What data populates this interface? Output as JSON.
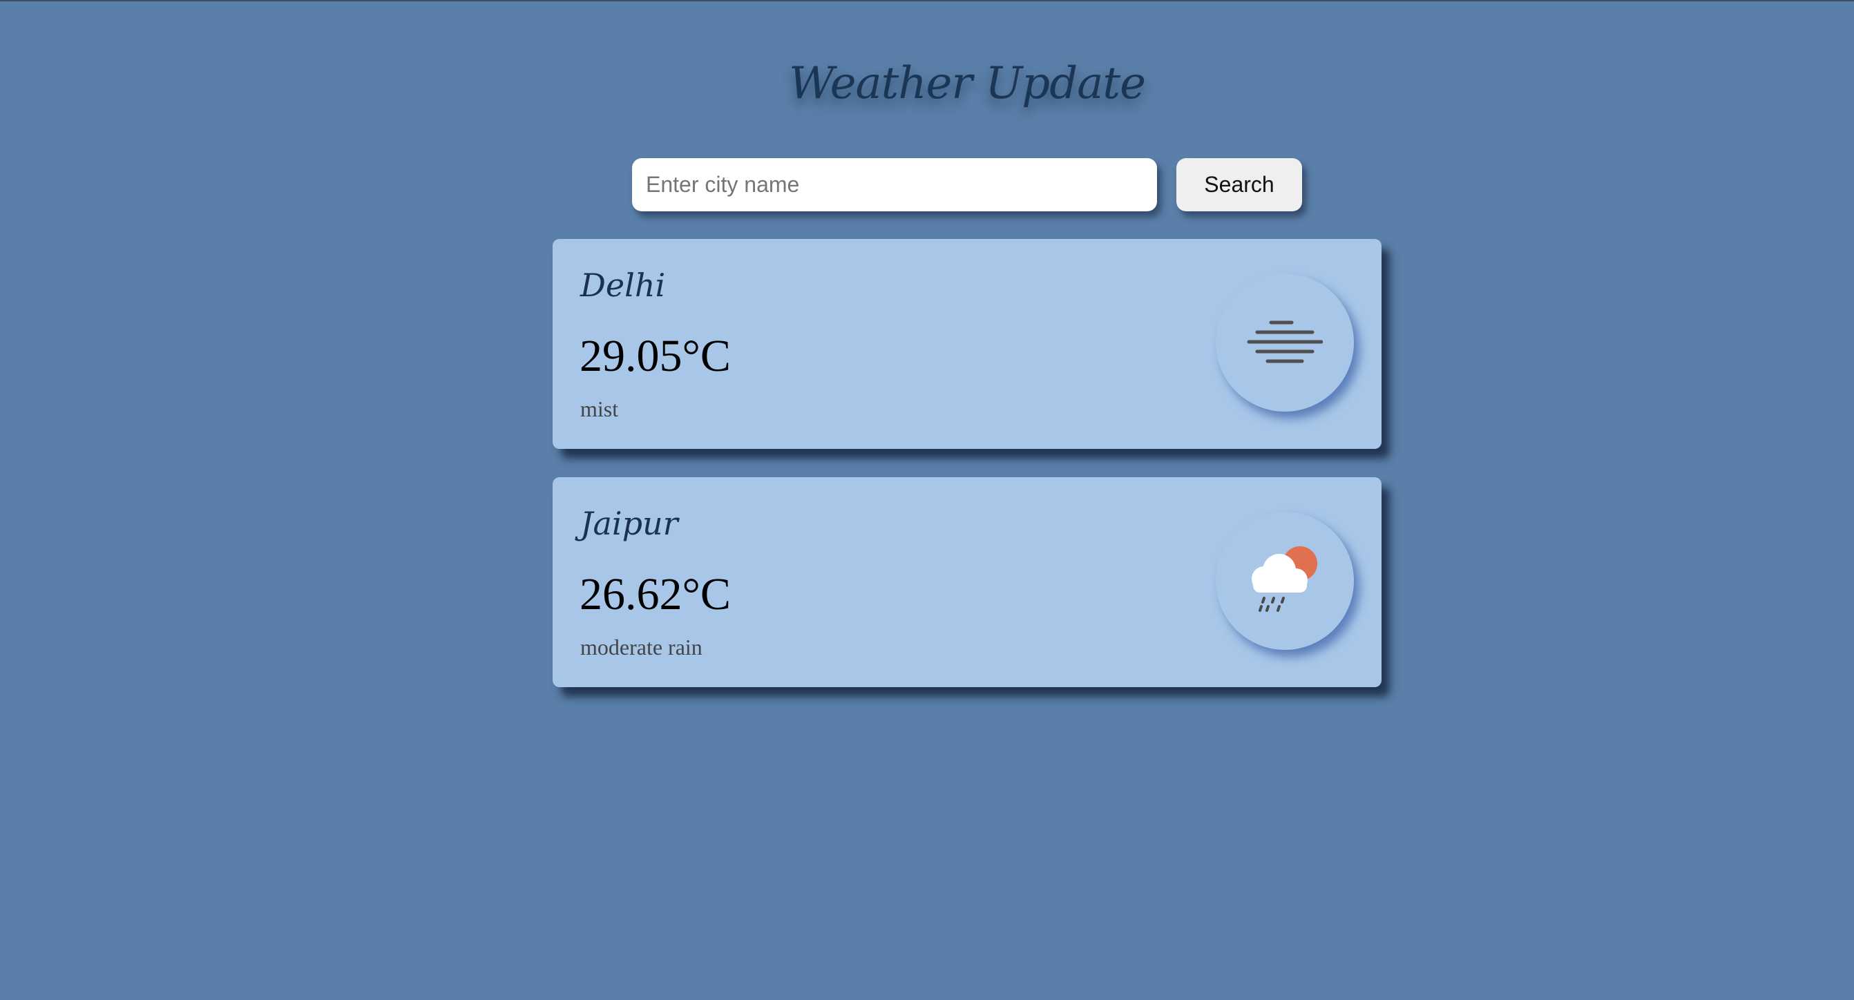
{
  "header": {
    "title": "Weather Update"
  },
  "search": {
    "placeholder": "Enter city name",
    "value": "",
    "button_label": "Search"
  },
  "cards": [
    {
      "city": "Delhi",
      "temperature": "29.05°C",
      "description": "mist",
      "icon": "mist-icon"
    },
    {
      "city": "Jaipur",
      "temperature": "26.62°C",
      "description": "moderate rain",
      "icon": "rain-sun-cloud-icon"
    }
  ],
  "colors": {
    "background": "#5a7fa8",
    "card": "#a8c6e8",
    "title": "#1b3554",
    "sun": "#e0704f"
  }
}
